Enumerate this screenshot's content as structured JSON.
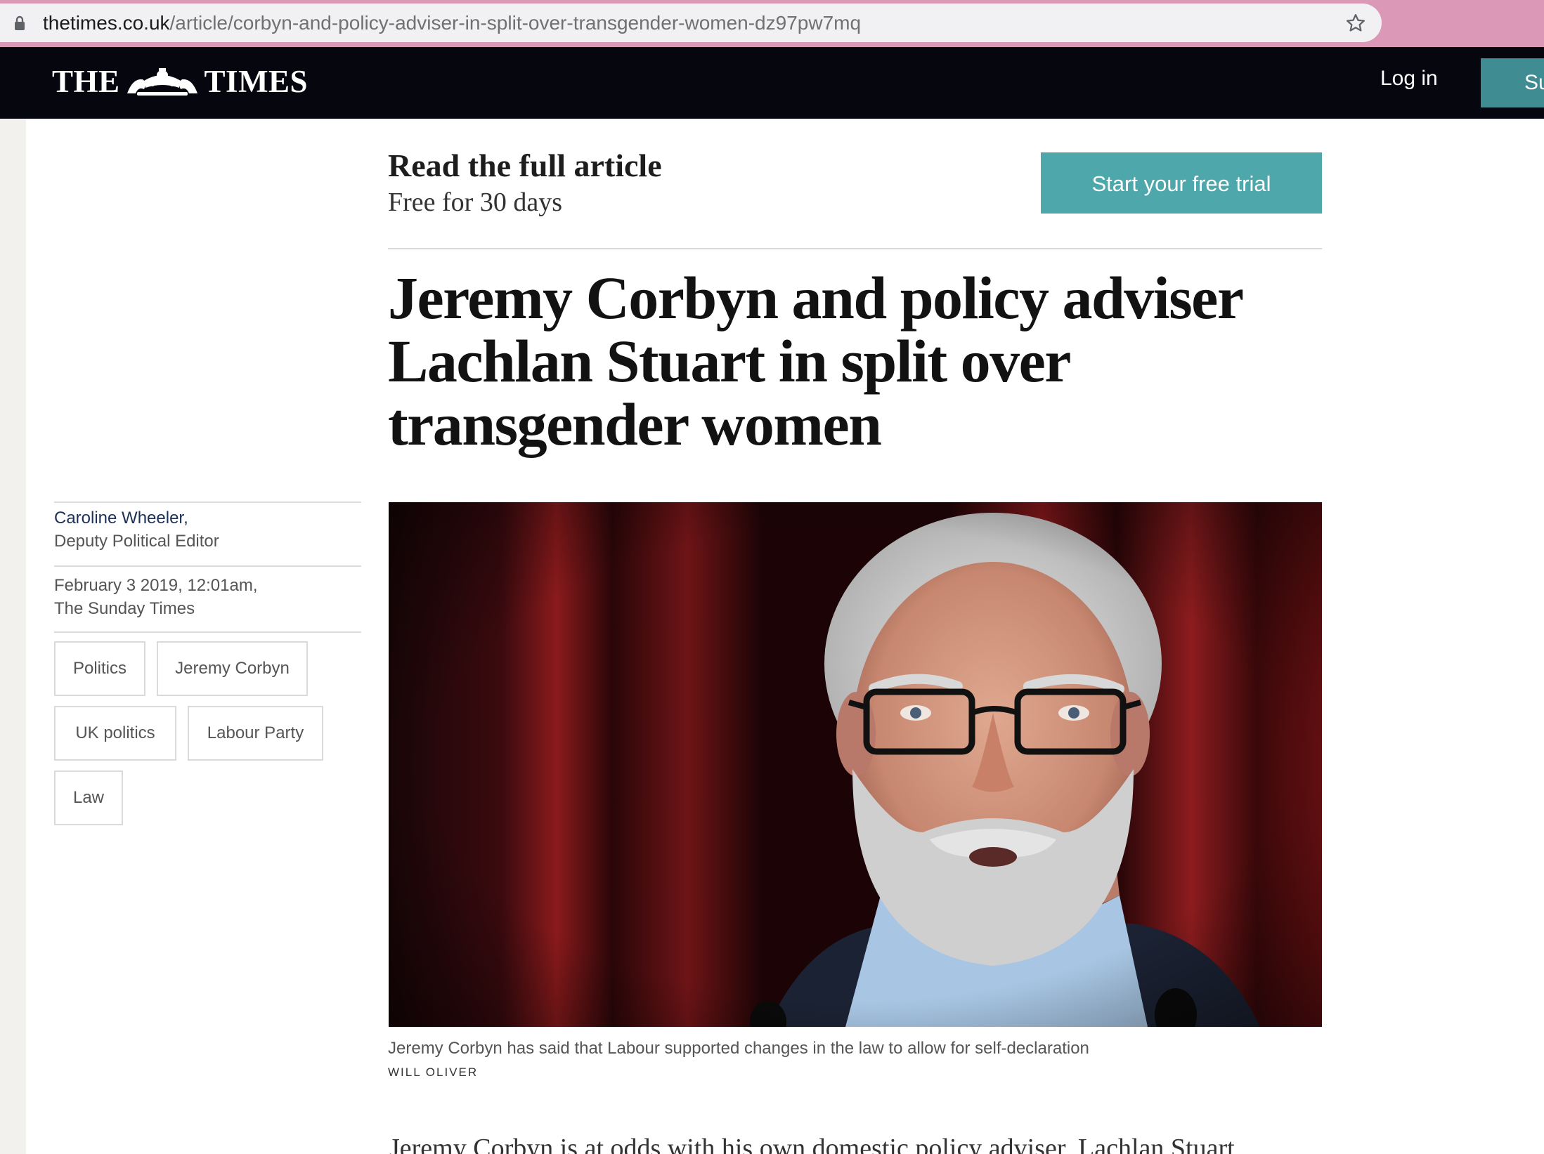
{
  "browser": {
    "url_domain": "thetimes.co.uk",
    "url_path": "/article/corbyn-and-policy-adviser-in-split-over-transgender-women-dz97pw7mq",
    "lock_icon": "lock-icon",
    "bookmark_icon": "star-icon"
  },
  "header": {
    "logo_left": "THE",
    "logo_right": "TIMES",
    "login_label": "Log in",
    "subscribe_label": "Su",
    "colors": {
      "background": "#06060f",
      "accent": "#3f8c93"
    }
  },
  "paywall": {
    "title": "Read the full article",
    "subtitle": "Free for 30 days",
    "cta_label": "Start your free trial",
    "cta_color": "#4ea7ab"
  },
  "article": {
    "headline": "Jeremy Corbyn and policy adviser Lachlan Stuart in split over transgender women",
    "author": "Caroline Wheeler,",
    "author_role": "Deputy Political Editor",
    "date": "February 3 2019, 12:01am,",
    "publication": "The Sunday Times",
    "tags": [
      "Politics",
      "Jeremy Corbyn",
      "UK politics",
      "Labour Party",
      "Law"
    ],
    "image_caption": "Jeremy Corbyn has said that Labour supported changes in the law to allow for self-declaration",
    "image_credit": "WILL OLIVER",
    "body_start": "Jeremy Corbyn is at odds with his own domestic policy adviser, Lachlan Stuart"
  }
}
